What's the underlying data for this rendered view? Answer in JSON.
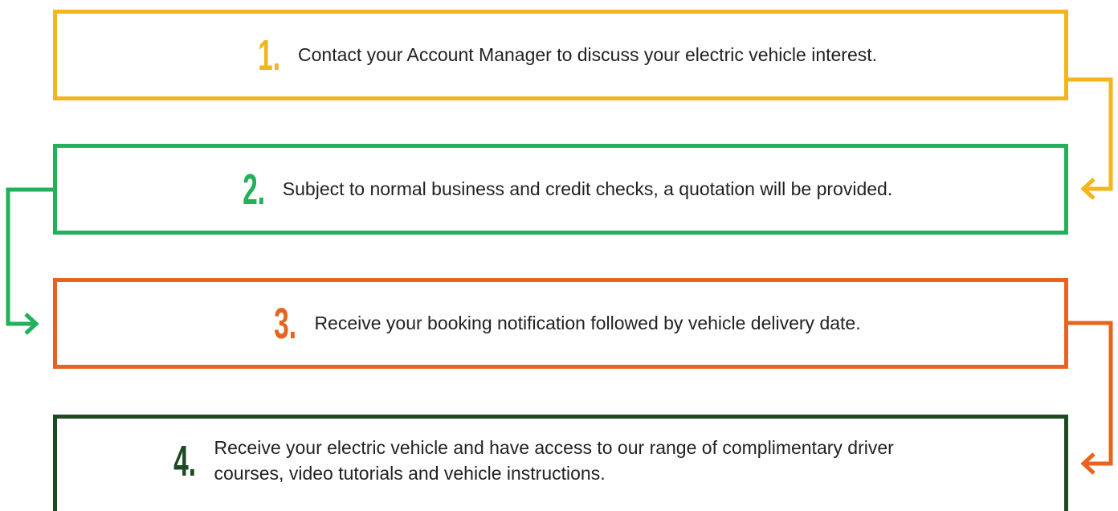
{
  "steps": [
    {
      "number": "1.",
      "text": "Contact your Account Manager to discuss your electric vehicle interest.",
      "color": "#F2B61C"
    },
    {
      "number": "2.",
      "text": "Subject to normal business and credit checks, a quotation will be provided.",
      "color": "#22B05A"
    },
    {
      "number": "3.",
      "text": "Receive your booking notification followed by vehicle delivery date.",
      "color": "#E8641E"
    },
    {
      "number": "4.",
      "text": "Receive your electric vehicle and have access to our range of complimentary driver courses, video tutorials and vehicle instructions.",
      "color": "#1E4A22"
    }
  ]
}
